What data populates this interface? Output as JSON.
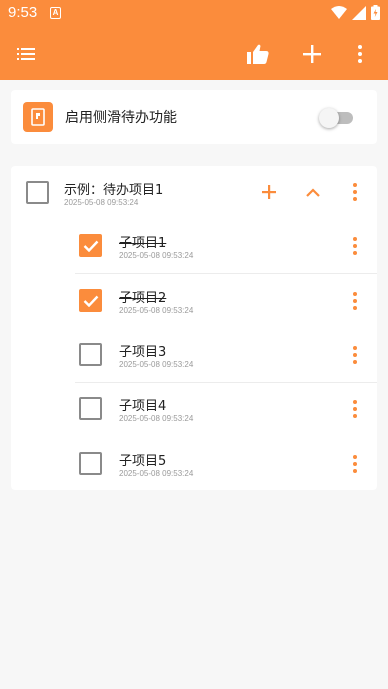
{
  "status_bar": {
    "time": "9:53",
    "notification_icon": "a-icon",
    "icons": [
      "wifi-icon",
      "signal-icon",
      "battery-icon"
    ]
  },
  "toolbar": {
    "menu_icon": "list-menu-icon",
    "actions": [
      "thumbs-up-icon",
      "add-icon",
      "more-vert-icon"
    ]
  },
  "feature": {
    "icon": "sidebar-todo-icon",
    "label": "启用侧滑待办功能",
    "enabled": false
  },
  "todo": {
    "parent": {
      "title": "示例：待办项目1",
      "time": "2025-05-08 09:53:24",
      "checked": false,
      "actions": [
        "add-icon",
        "chevron-up-icon",
        "more-vert-icon"
      ]
    },
    "children": [
      {
        "title": "子项目1",
        "time": "2025-05-08 09:53:24",
        "checked": true
      },
      {
        "title": "子项目2",
        "time": "2025-05-08 09:53:24",
        "checked": true
      },
      {
        "title": "子项目3",
        "time": "2025-05-08 09:53:24",
        "checked": false
      },
      {
        "title": "子项目4",
        "time": "2025-05-08 09:53:24",
        "checked": false
      },
      {
        "title": "子项目5",
        "time": "2025-05-08 09:53:24",
        "checked": false
      }
    ]
  },
  "colors": {
    "accent": "#fb8c3c",
    "background": "#f7f7f7",
    "card": "#ffffff"
  }
}
